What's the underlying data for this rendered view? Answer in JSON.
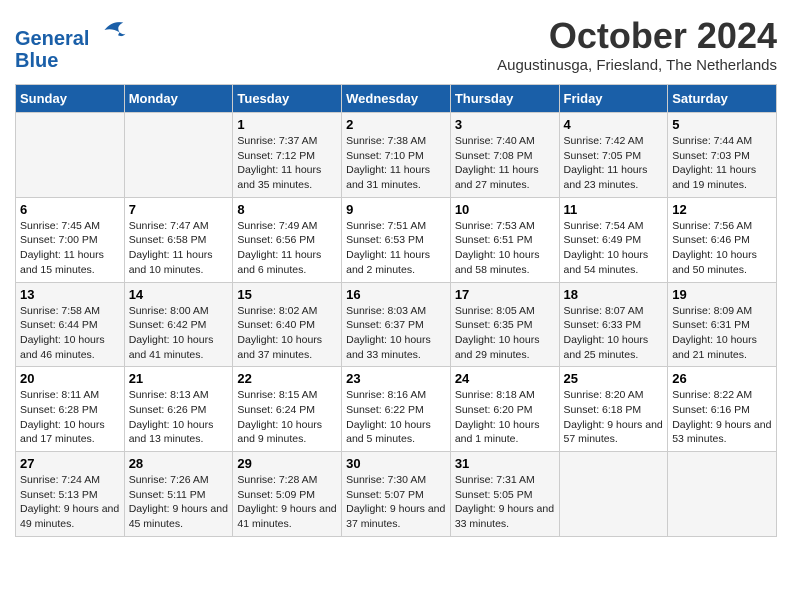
{
  "header": {
    "logo_line1": "General",
    "logo_line2": "Blue",
    "month_title": "October 2024",
    "location": "Augustinusga, Friesland, The Netherlands"
  },
  "days_of_week": [
    "Sunday",
    "Monday",
    "Tuesday",
    "Wednesday",
    "Thursday",
    "Friday",
    "Saturday"
  ],
  "weeks": [
    [
      {
        "day": "",
        "info": ""
      },
      {
        "day": "",
        "info": ""
      },
      {
        "day": "1",
        "info": "Sunrise: 7:37 AM\nSunset: 7:12 PM\nDaylight: 11 hours and 35 minutes."
      },
      {
        "day": "2",
        "info": "Sunrise: 7:38 AM\nSunset: 7:10 PM\nDaylight: 11 hours and 31 minutes."
      },
      {
        "day": "3",
        "info": "Sunrise: 7:40 AM\nSunset: 7:08 PM\nDaylight: 11 hours and 27 minutes."
      },
      {
        "day": "4",
        "info": "Sunrise: 7:42 AM\nSunset: 7:05 PM\nDaylight: 11 hours and 23 minutes."
      },
      {
        "day": "5",
        "info": "Sunrise: 7:44 AM\nSunset: 7:03 PM\nDaylight: 11 hours and 19 minutes."
      }
    ],
    [
      {
        "day": "6",
        "info": "Sunrise: 7:45 AM\nSunset: 7:00 PM\nDaylight: 11 hours and 15 minutes."
      },
      {
        "day": "7",
        "info": "Sunrise: 7:47 AM\nSunset: 6:58 PM\nDaylight: 11 hours and 10 minutes."
      },
      {
        "day": "8",
        "info": "Sunrise: 7:49 AM\nSunset: 6:56 PM\nDaylight: 11 hours and 6 minutes."
      },
      {
        "day": "9",
        "info": "Sunrise: 7:51 AM\nSunset: 6:53 PM\nDaylight: 11 hours and 2 minutes."
      },
      {
        "day": "10",
        "info": "Sunrise: 7:53 AM\nSunset: 6:51 PM\nDaylight: 10 hours and 58 minutes."
      },
      {
        "day": "11",
        "info": "Sunrise: 7:54 AM\nSunset: 6:49 PM\nDaylight: 10 hours and 54 minutes."
      },
      {
        "day": "12",
        "info": "Sunrise: 7:56 AM\nSunset: 6:46 PM\nDaylight: 10 hours and 50 minutes."
      }
    ],
    [
      {
        "day": "13",
        "info": "Sunrise: 7:58 AM\nSunset: 6:44 PM\nDaylight: 10 hours and 46 minutes."
      },
      {
        "day": "14",
        "info": "Sunrise: 8:00 AM\nSunset: 6:42 PM\nDaylight: 10 hours and 41 minutes."
      },
      {
        "day": "15",
        "info": "Sunrise: 8:02 AM\nSunset: 6:40 PM\nDaylight: 10 hours and 37 minutes."
      },
      {
        "day": "16",
        "info": "Sunrise: 8:03 AM\nSunset: 6:37 PM\nDaylight: 10 hours and 33 minutes."
      },
      {
        "day": "17",
        "info": "Sunrise: 8:05 AM\nSunset: 6:35 PM\nDaylight: 10 hours and 29 minutes."
      },
      {
        "day": "18",
        "info": "Sunrise: 8:07 AM\nSunset: 6:33 PM\nDaylight: 10 hours and 25 minutes."
      },
      {
        "day": "19",
        "info": "Sunrise: 8:09 AM\nSunset: 6:31 PM\nDaylight: 10 hours and 21 minutes."
      }
    ],
    [
      {
        "day": "20",
        "info": "Sunrise: 8:11 AM\nSunset: 6:28 PM\nDaylight: 10 hours and 17 minutes."
      },
      {
        "day": "21",
        "info": "Sunrise: 8:13 AM\nSunset: 6:26 PM\nDaylight: 10 hours and 13 minutes."
      },
      {
        "day": "22",
        "info": "Sunrise: 8:15 AM\nSunset: 6:24 PM\nDaylight: 10 hours and 9 minutes."
      },
      {
        "day": "23",
        "info": "Sunrise: 8:16 AM\nSunset: 6:22 PM\nDaylight: 10 hours and 5 minutes."
      },
      {
        "day": "24",
        "info": "Sunrise: 8:18 AM\nSunset: 6:20 PM\nDaylight: 10 hours and 1 minute."
      },
      {
        "day": "25",
        "info": "Sunrise: 8:20 AM\nSunset: 6:18 PM\nDaylight: 9 hours and 57 minutes."
      },
      {
        "day": "26",
        "info": "Sunrise: 8:22 AM\nSunset: 6:16 PM\nDaylight: 9 hours and 53 minutes."
      }
    ],
    [
      {
        "day": "27",
        "info": "Sunrise: 7:24 AM\nSunset: 5:13 PM\nDaylight: 9 hours and 49 minutes."
      },
      {
        "day": "28",
        "info": "Sunrise: 7:26 AM\nSunset: 5:11 PM\nDaylight: 9 hours and 45 minutes."
      },
      {
        "day": "29",
        "info": "Sunrise: 7:28 AM\nSunset: 5:09 PM\nDaylight: 9 hours and 41 minutes."
      },
      {
        "day": "30",
        "info": "Sunrise: 7:30 AM\nSunset: 5:07 PM\nDaylight: 9 hours and 37 minutes."
      },
      {
        "day": "31",
        "info": "Sunrise: 7:31 AM\nSunset: 5:05 PM\nDaylight: 9 hours and 33 minutes."
      },
      {
        "day": "",
        "info": ""
      },
      {
        "day": "",
        "info": ""
      }
    ]
  ]
}
